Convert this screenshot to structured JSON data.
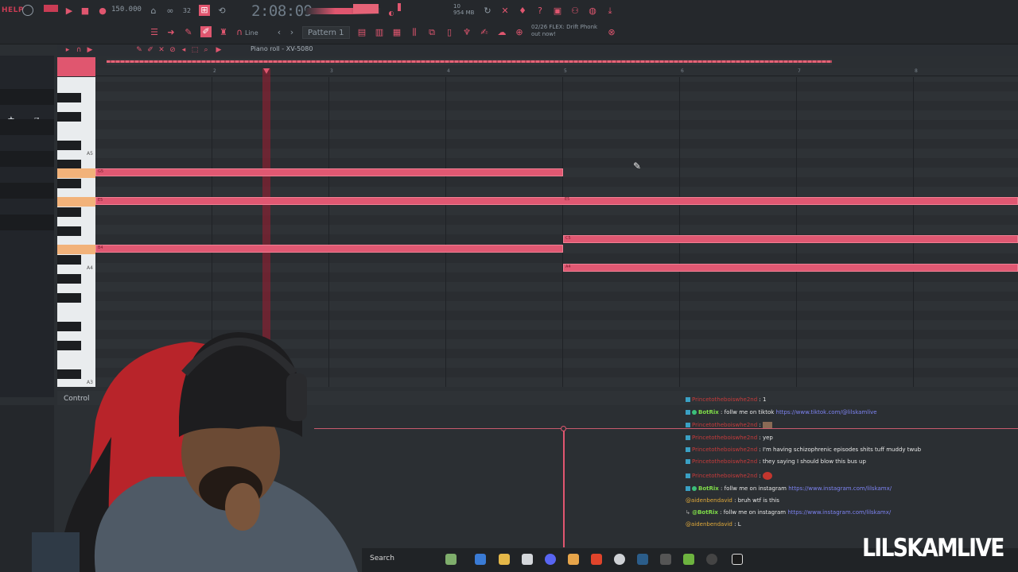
{
  "toolbar": {
    "help_label": "HELP",
    "tempo": "150.000",
    "time": "2:08:09",
    "line_mode": "Line",
    "pattern": "Pattern 1",
    "memory": "954 MB",
    "cpu": "10",
    "news_line1": "02/26  FLEX: Drift Phonk",
    "news_line2": "out now!",
    "accent_color": "#e0566f"
  },
  "piano_roll": {
    "title": "Piano roll - XV-5080",
    "ruler": [
      "2",
      "3",
      "4",
      "5",
      "6",
      "7",
      "8"
    ],
    "key_labels": [
      "A5",
      "A4",
      "A3"
    ],
    "notes": [
      {
        "label": "G5"
      },
      {
        "label": "E5"
      },
      {
        "label": "E5"
      },
      {
        "label": "C5"
      },
      {
        "label": "B4"
      },
      {
        "label": "A4"
      }
    ],
    "event_lane_label": "Control"
  },
  "chat": {
    "messages": [
      {
        "user": "Princetotheboiswhe2nd",
        "text": "1",
        "user_color": "red"
      },
      {
        "user": "BotRix",
        "text": "follw me on tiktok ",
        "link": "https://www.tiktok.com/@lilskamlive",
        "user_color": "green"
      },
      {
        "user": "Princetotheboiswhe2nd",
        "text": "",
        "user_color": "red"
      },
      {
        "user": "Princetotheboiswhe2nd",
        "text": "yep",
        "user_color": "red"
      },
      {
        "user": "Princetotheboiswhe2nd",
        "text": "I'm having schizophrenic episodes shits tuff muddy twub",
        "user_color": "red"
      },
      {
        "user": "Princetotheboiswhe2nd",
        "text": "they saying I should blow this bus up",
        "user_color": "red"
      },
      {
        "user": "Princetotheboiswhe2nd",
        "text": "",
        "user_color": "red"
      },
      {
        "user": "BotRix",
        "text": "follw me on instagram ",
        "link": "https://www.instagram.com/lilskamx/",
        "user_color": "green"
      },
      {
        "user": "@aidenbendavid",
        "text": "bruh wtf is this",
        "user_color": "orange"
      },
      {
        "user": "@BotRix",
        "text": "follw me on instagram ",
        "link": "https://www.instagram.com/lilskamx/",
        "user_color": "green"
      },
      {
        "user": "@aidenbendavid",
        "text": "L",
        "user_color": "orange"
      }
    ]
  },
  "taskbar": {
    "search_label": "Search"
  },
  "overlay": {
    "brand": "LILSKAMLIVE"
  }
}
